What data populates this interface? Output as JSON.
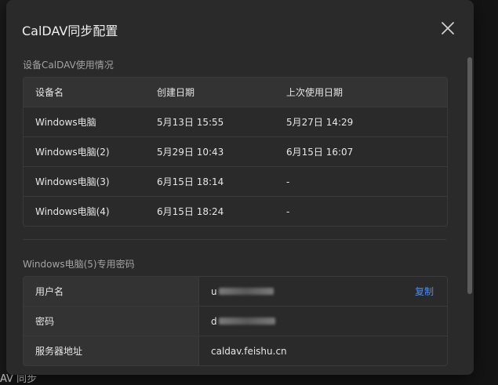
{
  "dialog": {
    "title": "CalDAV同步配置",
    "close_icon": "close-icon"
  },
  "devices_section": {
    "label": "设备CalDAV使用情况",
    "columns": [
      "设备名",
      "创建日期",
      "上次使用日期"
    ],
    "rows": [
      [
        "Windows电脑",
        "5月13日 15:55",
        "5月27日 14:29"
      ],
      [
        "Windows电脑(2)",
        "5月29日 10:43",
        "6月15日 16:07"
      ],
      [
        "Windows电脑(3)",
        "6月15日 18:14",
        "-"
      ],
      [
        "Windows电脑(4)",
        "6月15日 18:24",
        "-"
      ]
    ]
  },
  "password_section": {
    "label": "Windows电脑(5)专用密码",
    "username_label": "用户名",
    "username_value": "u",
    "copy_label": "复制",
    "password_label": "密码",
    "password_value": "d",
    "server_label": "服务器地址",
    "server_value": "caldav.feishu.cn"
  },
  "background": {
    "bottom_text": "AV 同步"
  },
  "colors": {
    "dialog_bg": "#2a2a2a",
    "header_cell_bg": "#333333",
    "link": "#4a8cf7"
  }
}
